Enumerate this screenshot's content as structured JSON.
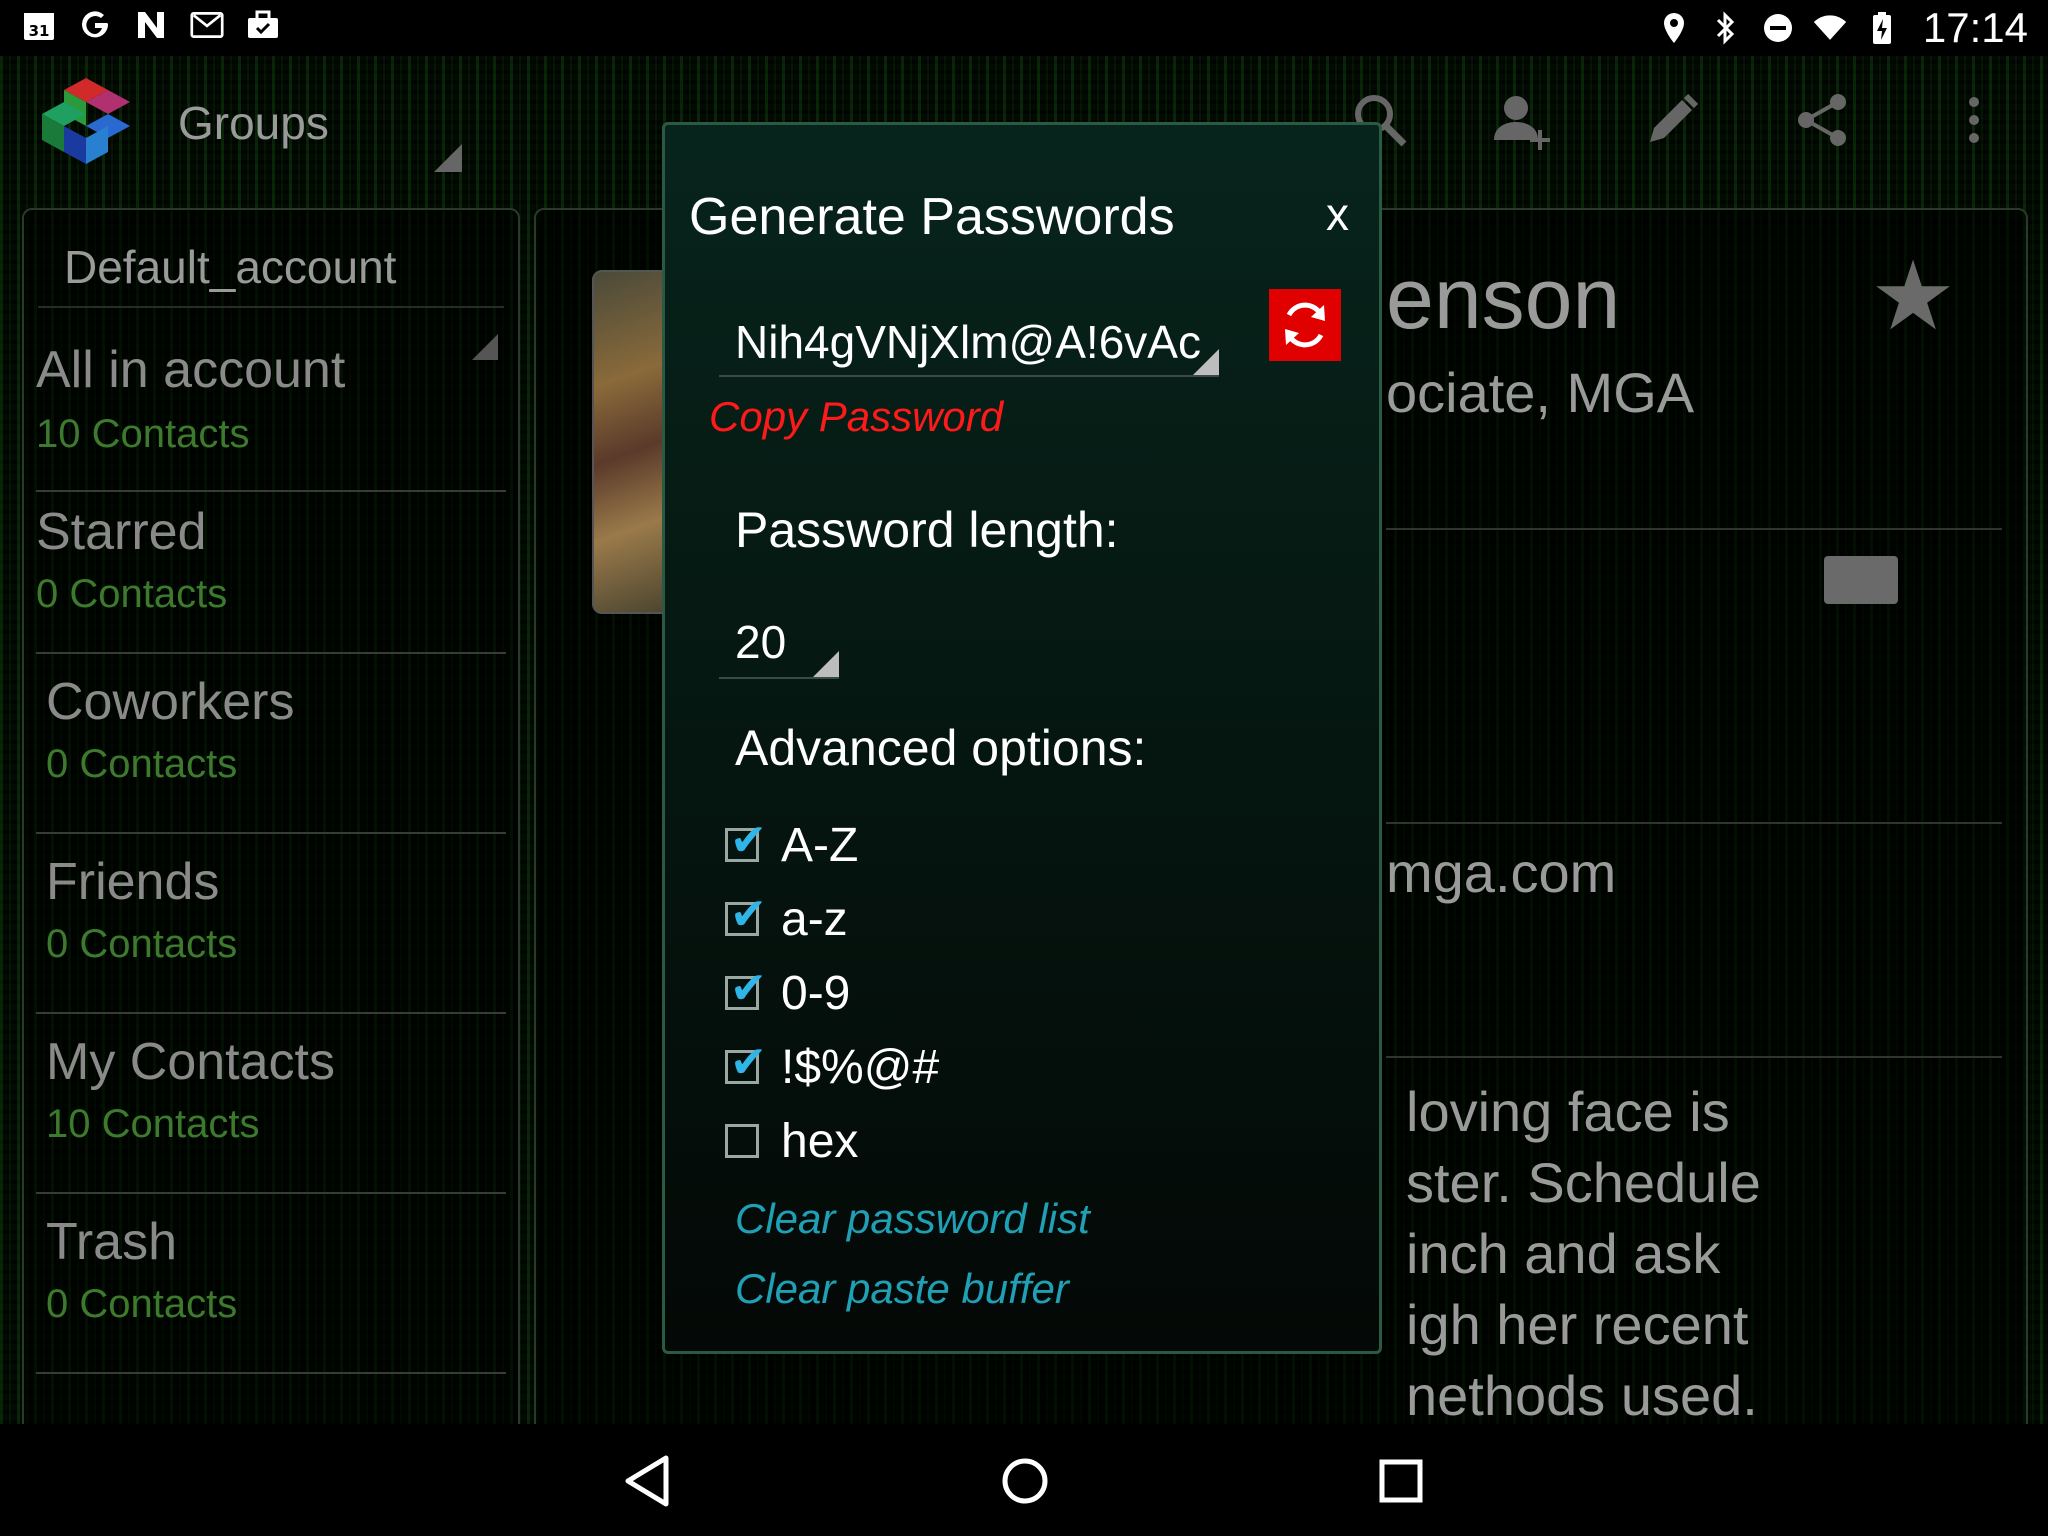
{
  "status_bar": {
    "time": "17:14",
    "left_icons": [
      "calendar-icon",
      "google-icon",
      "nfc-icon",
      "gmail-icon",
      "briefcase-icon"
    ],
    "calendar_day": "31",
    "right_icons": [
      "location-icon",
      "bluetooth-icon",
      "do-not-disturb-icon",
      "wifi-icon",
      "battery-charging-icon"
    ]
  },
  "app_bar": {
    "title": "Groups",
    "actions": [
      "search-icon",
      "add-contact-icon",
      "edit-icon",
      "share-icon",
      "overflow-menu-icon"
    ]
  },
  "left_panel": {
    "account": "Default_account",
    "groups": [
      {
        "name": "All in account",
        "count": "10 Contacts"
      },
      {
        "name": "Starred",
        "count": "0 Contacts"
      },
      {
        "name": "Coworkers",
        "count": "0 Contacts"
      },
      {
        "name": "Friends",
        "count": "0 Contacts"
      },
      {
        "name": "My Contacts",
        "count": "10 Contacts"
      },
      {
        "name": "Trash",
        "count": "0 Contacts"
      }
    ]
  },
  "contact_detail": {
    "name_partial": "enson",
    "title_partial": "ociate, MGA",
    "email_partial": "mga.com",
    "note_lines": [
      "loving face is",
      "ster.  Schedule",
      "inch and ask",
      "igh her recent",
      "nethods used."
    ]
  },
  "dialog": {
    "title": "Generate Passwords",
    "close_label": "x",
    "password": "Nih4gVNjXlm@A!6vAc",
    "copy_label": "Copy Password",
    "length_label": "Password length:",
    "length_value": "20",
    "advanced_label": "Advanced options:",
    "options": [
      {
        "label": "A-Z",
        "checked": true
      },
      {
        "label": "a-z",
        "checked": true
      },
      {
        "label": "0-9",
        "checked": true
      },
      {
        "label": "!$%@#",
        "checked": true
      },
      {
        "label": "hex",
        "checked": false
      }
    ],
    "clear_list_label": "Clear password list",
    "clear_buffer_label": "Clear paste buffer"
  },
  "colors": {
    "refresh_button": "#e00000",
    "copy_link": "#ff1a1a",
    "action_link": "#1fa0b5",
    "checkbox_tick": "#2fb5e8",
    "group_count": "#3d7a2e"
  },
  "nav_bar": [
    "back-icon",
    "home-icon",
    "recents-icon"
  ]
}
